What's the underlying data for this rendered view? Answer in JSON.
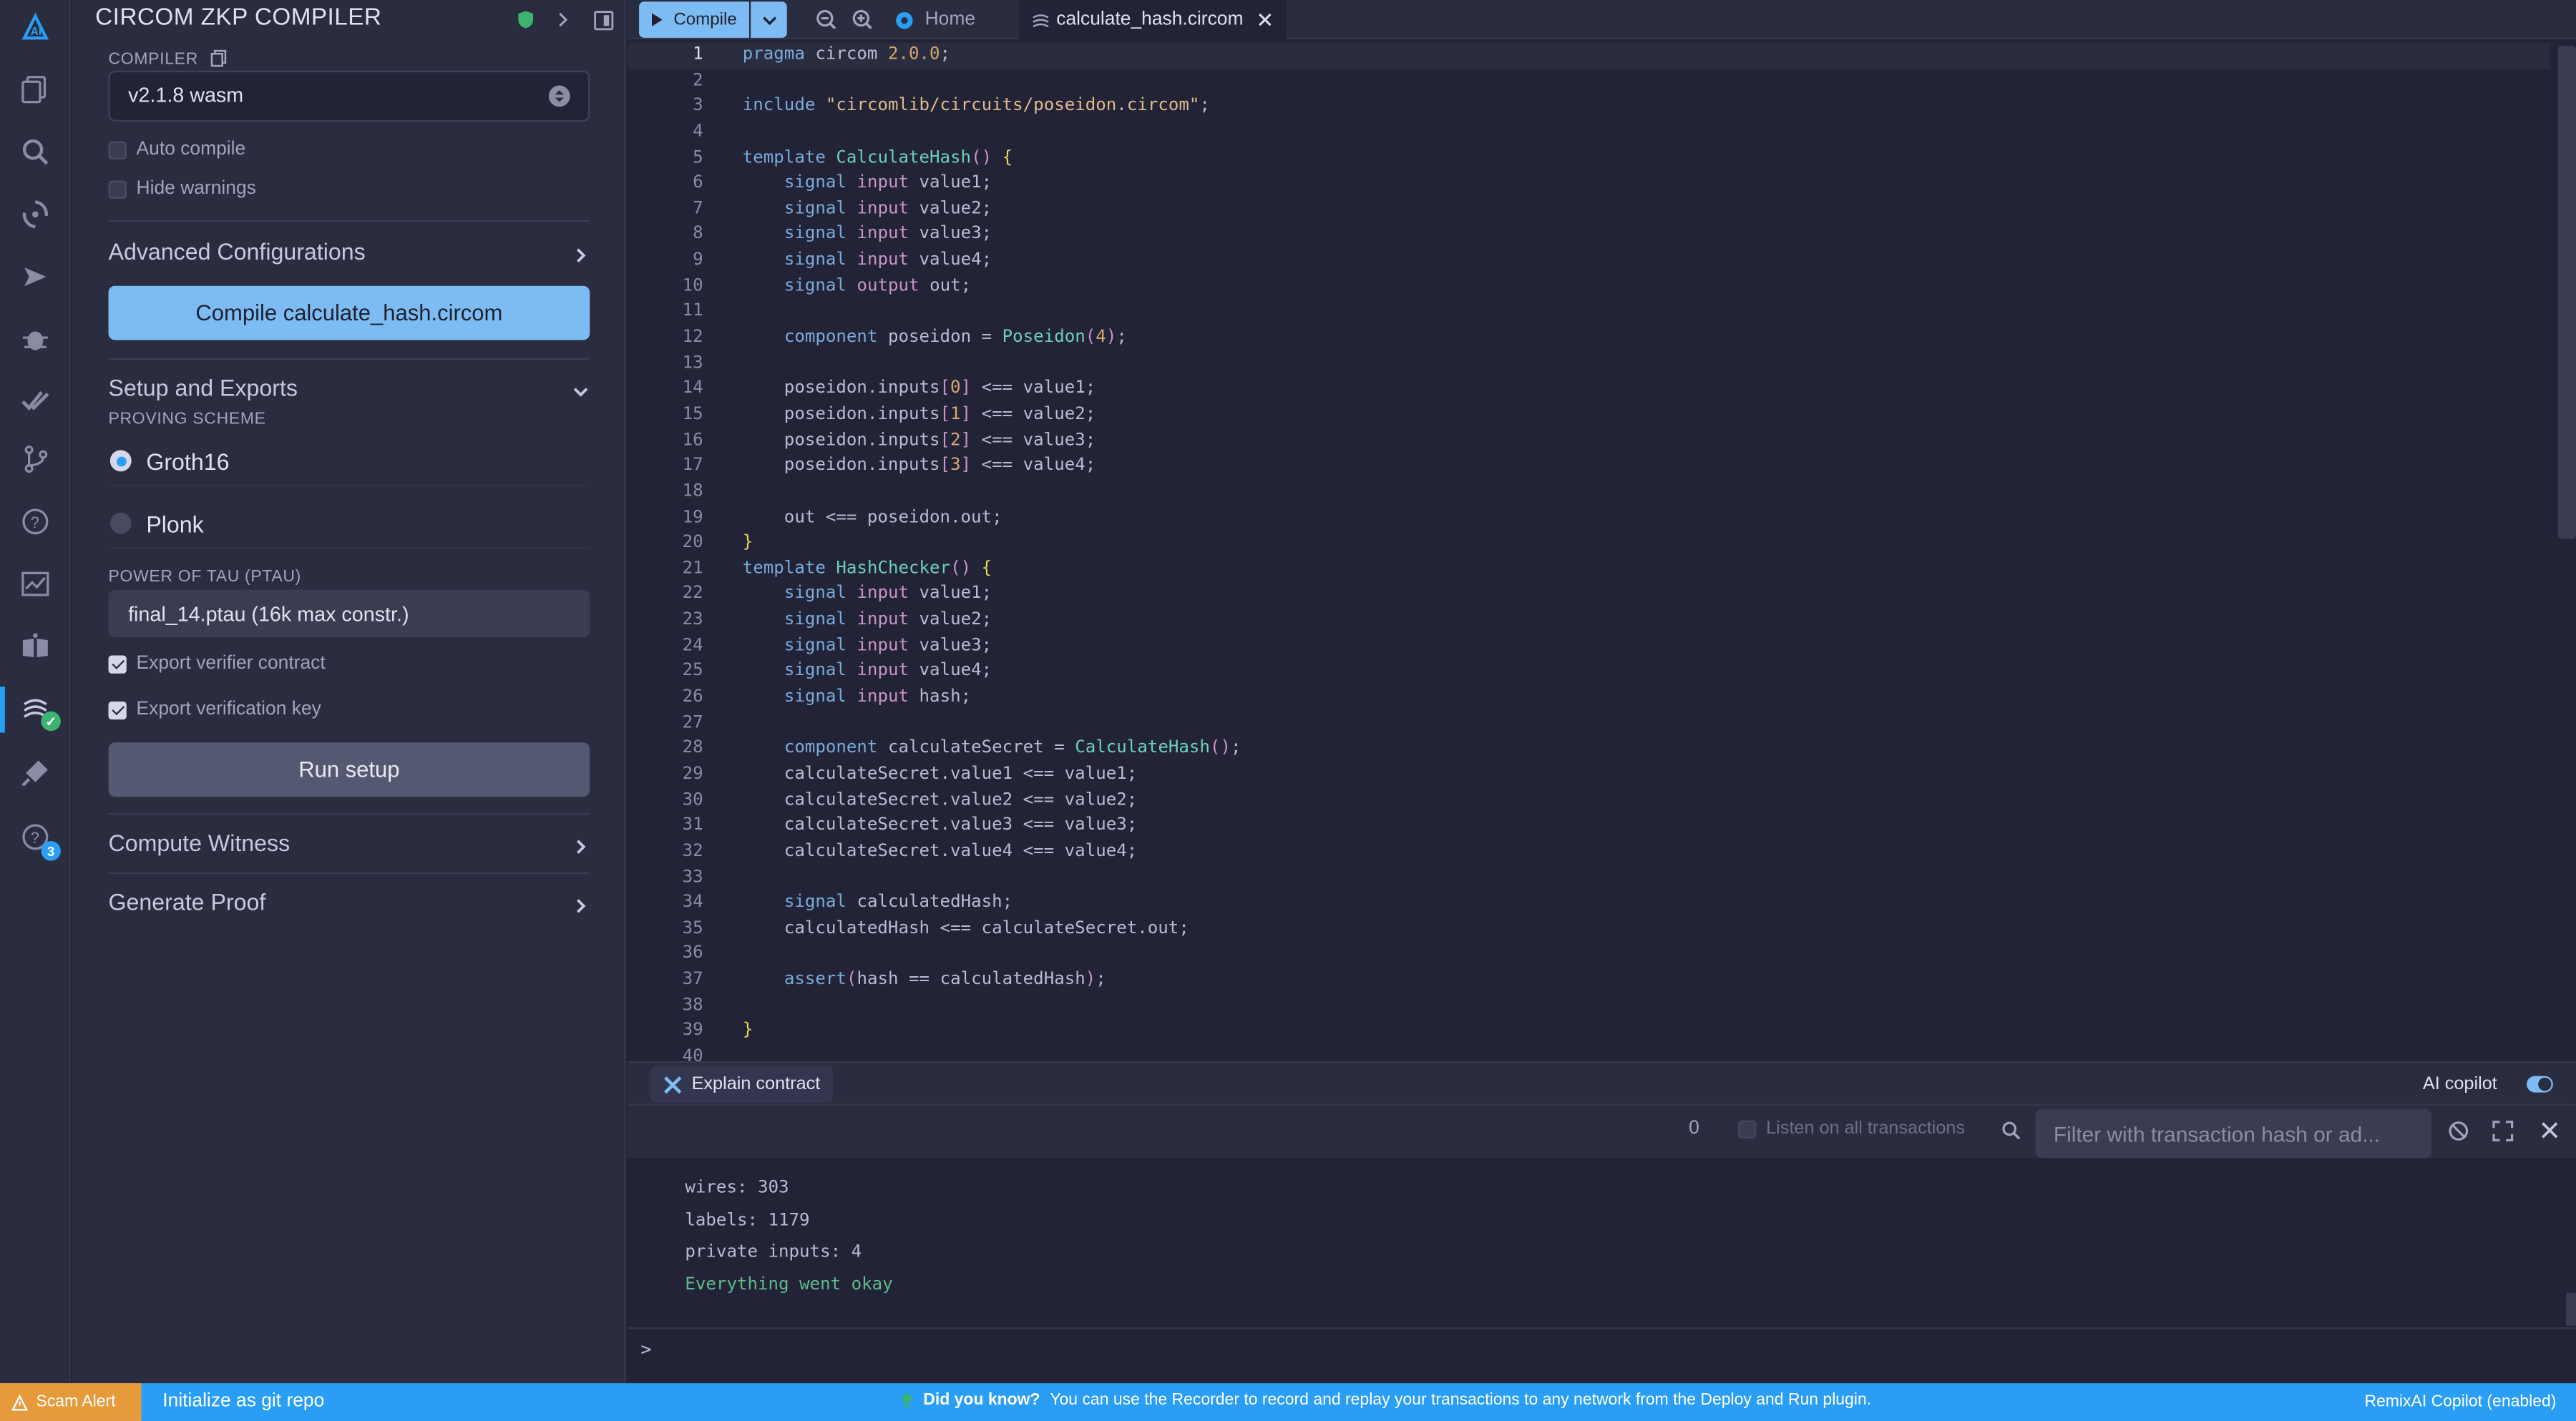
{
  "sidebar": {
    "badge_count": "3"
  },
  "panel": {
    "title": "CIRCOM ZKP COMPILER",
    "compiler_label": "COMPILER",
    "compiler_version": "v2.1.8 wasm",
    "auto_compile": "Auto compile",
    "hide_warnings": "Hide warnings",
    "advanced": "Advanced Configurations",
    "compile_button": "Compile calculate_hash.circom",
    "setup_exports": "Setup and Exports",
    "proving_scheme_label": "PROVING SCHEME",
    "scheme_groth16": "Groth16",
    "scheme_plonk": "Plonk",
    "ptau_label": "POWER OF TAU (PTAU)",
    "ptau_value": "final_14.ptau (16k max constr.)",
    "export_verifier": "Export verifier contract",
    "export_key": "Export verification key",
    "run_setup": "Run setup",
    "compute_witness": "Compute Witness",
    "generate_proof": "Generate Proof"
  },
  "topbar": {
    "compile": "Compile",
    "tab_home": "Home",
    "tab_file": "calculate_hash.circom"
  },
  "editor": {
    "lines": [
      "pragma circom 2.0.0;",
      "",
      "include \"circomlib/circuits/poseidon.circom\";",
      "",
      "template CalculateHash() {",
      "    signal input value1;",
      "    signal input value2;",
      "    signal input value3;",
      "    signal input value4;",
      "    signal output out;",
      "",
      "    component poseidon = Poseidon(4);",
      "",
      "    poseidon.inputs[0] <== value1;",
      "    poseidon.inputs[1] <== value2;",
      "    poseidon.inputs[2] <== value3;",
      "    poseidon.inputs[3] <== value4;",
      "",
      "    out <== poseidon.out;",
      "}",
      "template HashChecker() {",
      "    signal input value1;",
      "    signal input value2;",
      "    signal input value3;",
      "    signal input value4;",
      "    signal input hash;",
      "",
      "    component calculateSecret = CalculateHash();",
      "    calculateSecret.value1 <== value1;",
      "    calculateSecret.value2 <== value2;",
      "    calculateSecret.value3 <== value3;",
      "    calculateSecret.value4 <== value4;",
      "",
      "    signal calculatedHash;",
      "    calculatedHash <== calculateSecret.out;",
      "",
      "    assert(hash == calculatedHash);",
      "",
      "}",
      ""
    ]
  },
  "explain": {
    "button": "Explain contract",
    "copilot": "AI copilot"
  },
  "terminal": {
    "count": "0",
    "listen": "Listen on all transactions",
    "filter_placeholder": "Filter with transaction hash or ad...",
    "lines": [
      "wires: 303",
      "labels: 1179",
      "private inputs: 4"
    ],
    "ok_line": "Everything went okay",
    "prompt": ">"
  },
  "statusbar": {
    "scam_alert": "Scam Alert",
    "git_init": "Initialize as git repo",
    "tip_title": "Did you know?",
    "tip_text": "You can use the Recorder to record and replay your transactions to any network from the Deploy and Run plugin.",
    "remix_ai": "RemixAI Copilot (enabled)"
  },
  "colors": {
    "accent": "#2a9df4",
    "primary_button": "#7cbcf3",
    "scam_alert": "#e79a3c",
    "success_text": "#5dbb8a"
  },
  "icons": [
    "remix-logo-icon",
    "file-explorer-icon",
    "search-icon",
    "solidity-compiler-icon",
    "deploy-run-icon",
    "debugger-icon",
    "unit-test-icon",
    "git-icon",
    "help-icon",
    "solidity-analyzers-icon",
    "learneth-icon",
    "circom-icon",
    "plugin-manager-icon",
    "settings-icon"
  ]
}
